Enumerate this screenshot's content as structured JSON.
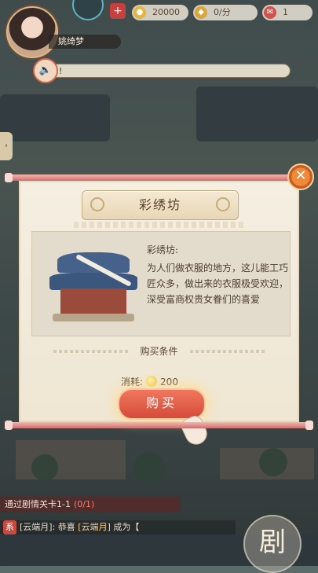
{
  "hud": {
    "player_name": "姚绮梦",
    "coins": "20000",
    "score": "0/分",
    "extra_count": "1"
  },
  "notice": {
    "text": "!"
  },
  "modal": {
    "title": "彩绣坊",
    "desc_title": "彩绣坊:",
    "desc_body": "为人们做衣服的地方，这儿能工巧匠众多，做出来的衣服极受欢迎，深受富商权贵女眷们的喜爱",
    "requirement_title": "购买条件",
    "cost_label": "消耗:",
    "cost_value": "200",
    "buy_label": "购买",
    "close_label": "✕"
  },
  "quest": {
    "label": "通过剧情关卡1-1",
    "progress": "(0/1)"
  },
  "chat": {
    "tag": "系",
    "text_before": "[云端月]: 恭喜 ",
    "name": "[云端月]",
    "text_after": " 成为【"
  },
  "story_button": {
    "label": "剧"
  },
  "icons": {
    "horn": "horn-icon",
    "coin": "coin-icon",
    "close": "close-icon",
    "hand": "tap-hand-icon",
    "gem": "gem-icon",
    "plus": "plus-icon"
  }
}
